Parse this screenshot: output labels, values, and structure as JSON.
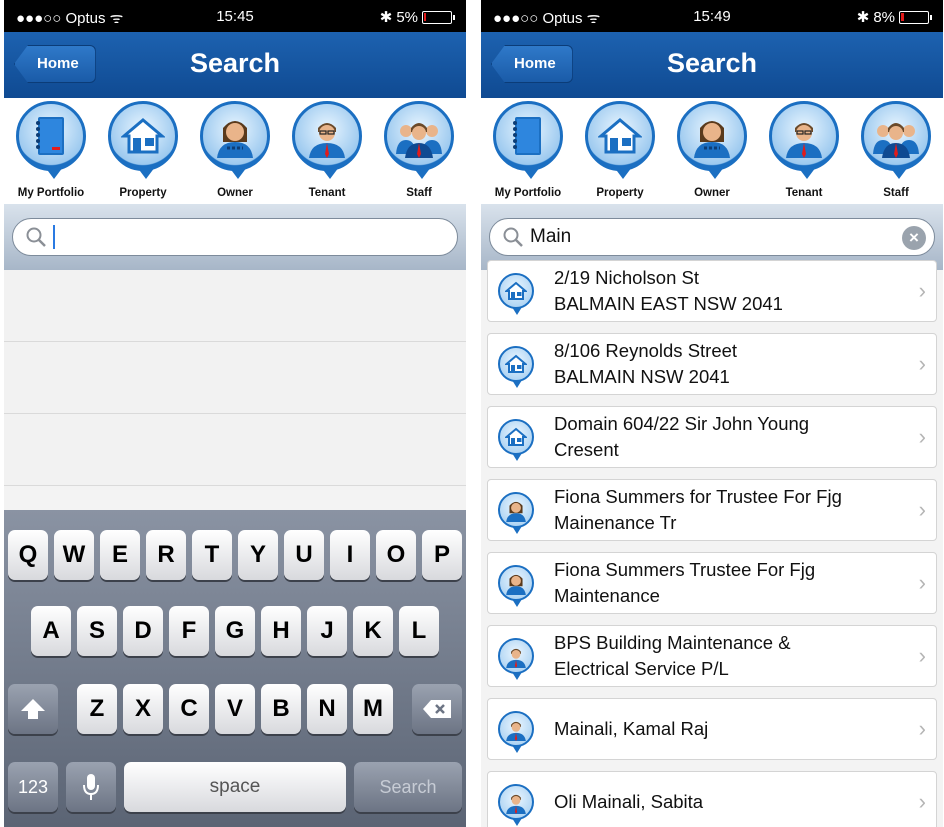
{
  "left": {
    "status": {
      "carrier": "●●●○○ Optus ᯤ",
      "time": "15:45",
      "battery": "5%",
      "battery_level": 0.05
    },
    "nav": {
      "home_label": "Home",
      "title": "Search"
    },
    "categories": [
      "My Portfolio",
      "Property",
      "Owner",
      "Tenant",
      "Staff"
    ],
    "search": {
      "value": ""
    },
    "keyboard": {
      "row1": [
        "Q",
        "W",
        "E",
        "R",
        "T",
        "Y",
        "U",
        "I",
        "O",
        "P"
      ],
      "row2": [
        "A",
        "S",
        "D",
        "F",
        "G",
        "H",
        "J",
        "K",
        "L"
      ],
      "row3": [
        "Z",
        "X",
        "C",
        "V",
        "B",
        "N",
        "M"
      ],
      "numbers_label": "123",
      "space_label": "space",
      "search_label": "Search"
    }
  },
  "right": {
    "status": {
      "carrier": "●●●○○ Optus ᯤ",
      "time": "15:49",
      "battery": "8%",
      "battery_level": 0.08
    },
    "nav": {
      "home_label": "Home",
      "title": "Search"
    },
    "categories": [
      "My Portfolio",
      "Property",
      "Owner",
      "Tenant",
      "Staff"
    ],
    "search": {
      "value": "Main"
    },
    "results": [
      {
        "type": "property",
        "line1": "2/19 Nicholson St",
        "line2": "BALMAIN EAST NSW 2041"
      },
      {
        "type": "property",
        "line1": "8/106 Reynolds  Street",
        "line2": "BALMAIN NSW 2041"
      },
      {
        "type": "property",
        "line1": "Domain 604/22 Sir John Young",
        "line2": "Cresent"
      },
      {
        "type": "owner",
        "line1": "Fiona Summers for  Trustee For Fjg",
        "line2": "Mainenance Tr"
      },
      {
        "type": "owner",
        "line1": "Fiona Summers Trustee For Fjg",
        "line2": "Maintenance"
      },
      {
        "type": "tenant",
        "line1": "BPS Building Maintenance &",
        "line2": "Electrical Service P/L"
      },
      {
        "type": "tenant",
        "line1": "Mainali, Kamal Raj",
        "line2": ""
      },
      {
        "type": "tenant",
        "line1": "Oli Mainali, Sabita",
        "line2": ""
      }
    ]
  },
  "colors": {
    "nav_blue": "#0f4a92",
    "accent_blue": "#1b6fc2",
    "battery_low": "#e21b1b"
  }
}
